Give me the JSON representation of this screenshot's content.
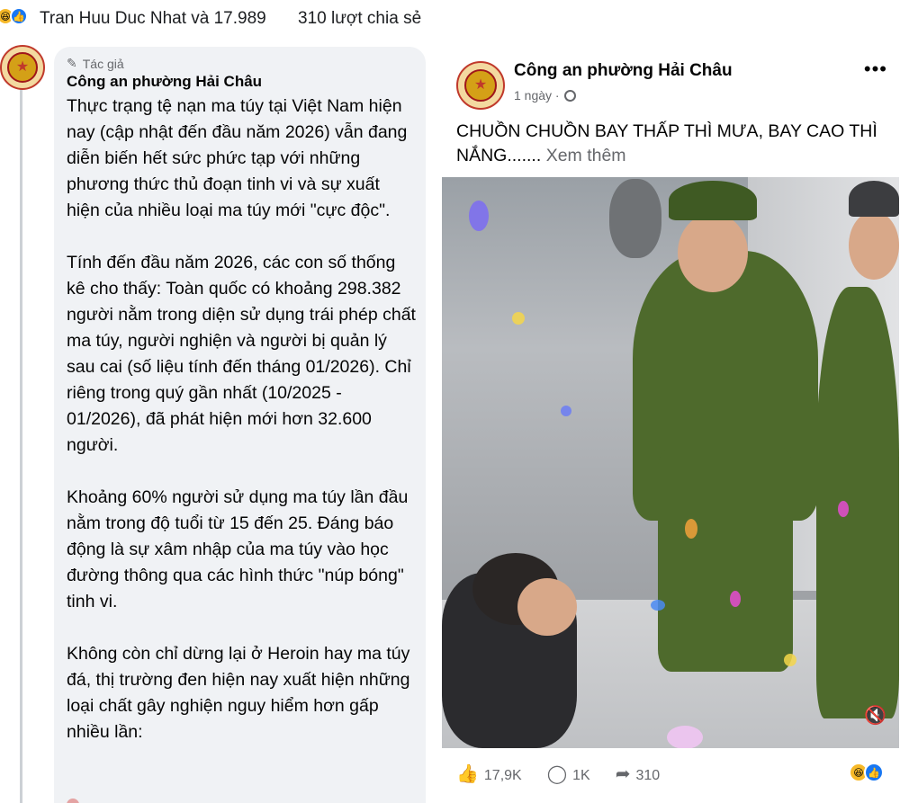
{
  "reaction_bar": {
    "names": "Tran Huu Duc Nhat và 17.989",
    "shares": "310 lượt chia sẻ"
  },
  "comment": {
    "tag": "Tác giả",
    "author": "Công an phường Hải Châu",
    "paragraphs": [
      "Thực trạng tệ nạn ma túy tại Việt Nam hiện nay (cập nhật đến đầu năm 2026) vẫn đang diễn biến hết sức phức tạp với những phương thức thủ đoạn tinh vi và sự xuất hiện của nhiều loại ma túy mới \"cực độc\".",
      "Tính đến đầu năm 2026, các con số thống kê cho thấy: Toàn quốc có khoảng 298.382 người nằm trong diện sử dụng trái phép chất ma túy, người nghiện và người bị quản lý sau cai (số liệu tính đến tháng 01/2026). Chỉ riêng trong quý gần nhất (10/2025 - 01/2026), đã phát hiện mới hơn 32.600 người.",
      "Khoảng 60% người sử dụng ma túy lần đầu nằm trong độ tuổi từ 15 đến 25. Đáng báo động là sự xâm nhập của ma túy vào học đường thông qua các hình thức \"núp bóng\" tinh vi.",
      "Không còn chỉ dừng lại ở Heroin hay ma túy đá, thị trường đen hiện nay xuất hiện những loại chất gây nghiện nguy hiểm hơn gấp nhiều lần:"
    ]
  },
  "post": {
    "page_name": "Công an phường Hải Châu",
    "time": "1 ngày ·",
    "more": "•••",
    "caption": "CHUỒN CHUỒN BAY THẤP THÌ MƯA, BAY CAO THÌ NẮNG.......",
    "see_more": "Xem thêm",
    "likes": "17,9K",
    "comments": "1K",
    "shares": "310"
  },
  "icons": {
    "haha": "haha-reaction-icon",
    "like": "like-reaction-icon",
    "pencil": "pencil-icon",
    "globe": "globe-icon",
    "mute": "speaker-muted-icon"
  }
}
